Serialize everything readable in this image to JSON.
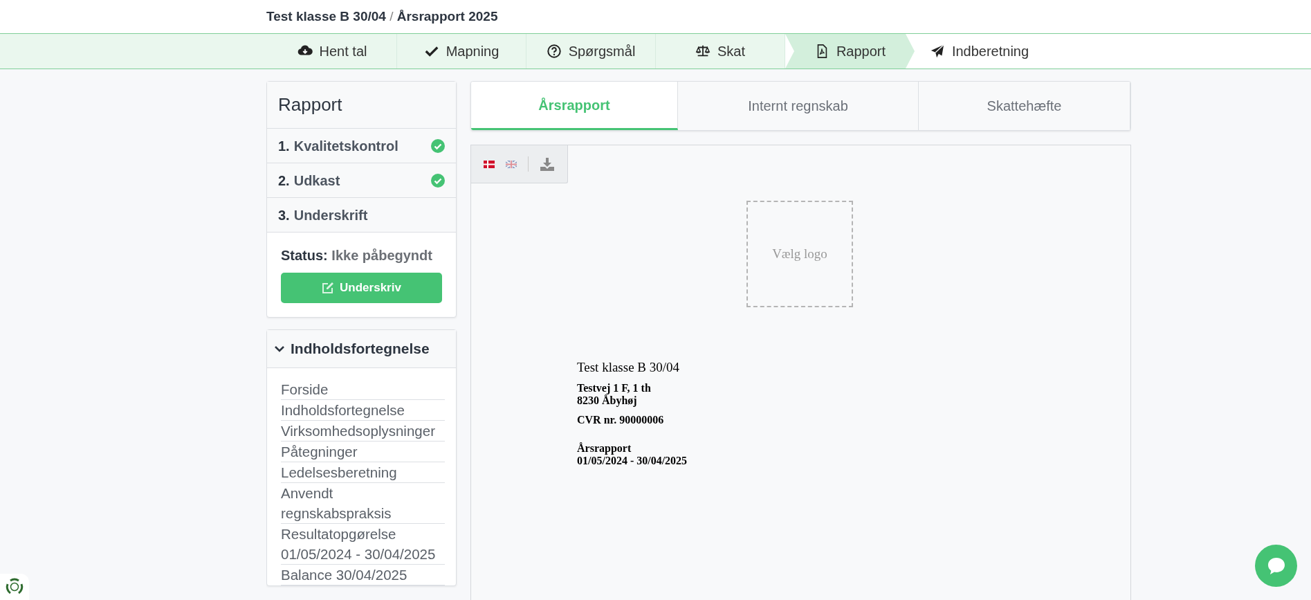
{
  "breadcrumb": {
    "company": "Test klasse B 30/04",
    "separator": "/",
    "report": "Årsrapport 2025"
  },
  "steps": [
    {
      "label": "Hent tal",
      "kind": "cloud",
      "completed": true,
      "selected": false
    },
    {
      "label": "Mapning",
      "kind": "check",
      "completed": true,
      "selected": false
    },
    {
      "label": "Spørgsmål",
      "kind": "question",
      "completed": true,
      "selected": false
    },
    {
      "label": "Skat",
      "kind": "scale",
      "completed": true,
      "selected": false
    },
    {
      "label": "Rapport",
      "kind": "pdf",
      "completed": false,
      "selected": true
    },
    {
      "label": "Indberetning",
      "kind": "send",
      "completed": false,
      "selected": false
    }
  ],
  "sidebar": {
    "title": "Rapport",
    "items": [
      {
        "number": "1.",
        "label": "Kvalitetskontrol",
        "completed": true
      },
      {
        "number": "2.",
        "label": "Udkast",
        "completed": true
      },
      {
        "number": "3.",
        "label": "Underskrift",
        "completed": false
      }
    ],
    "status_label": "Status:",
    "status_value": "Ikke påbegyndt",
    "sign_button": "Underskriv"
  },
  "toc": {
    "title": "Indholdsfortegnelse",
    "expanded": true,
    "items": [
      "Forside",
      "Indholdsfortegnelse",
      "Virksomhedsoplysninger",
      "Påtegninger",
      "Ledelsesberetning",
      "Anvendt regnskabspraksis",
      "Resultatopgørelse 01/05/2024 - 30/04/2025",
      "Balance 30/04/2025"
    ]
  },
  "tabs": [
    {
      "label": "Årsrapport",
      "selected": true
    },
    {
      "label": "Internt regnskab",
      "selected": false
    },
    {
      "label": "Skattehæfte",
      "selected": false
    }
  ],
  "toolbar": {
    "languages": [
      {
        "kind": "danish",
        "selected": true
      },
      {
        "kind": "english",
        "selected": false
      }
    ]
  },
  "document": {
    "logo_placeholder": "Vælg logo",
    "company": "Test klasse B 30/04",
    "address_lines": [
      "Testvej 1 F, 1 th",
      "8230 Åbyhøj"
    ],
    "cvr": "CVR nr. 90000006",
    "report_title": "Årsrapport",
    "period": "01/05/2024 - 30/04/2025"
  }
}
